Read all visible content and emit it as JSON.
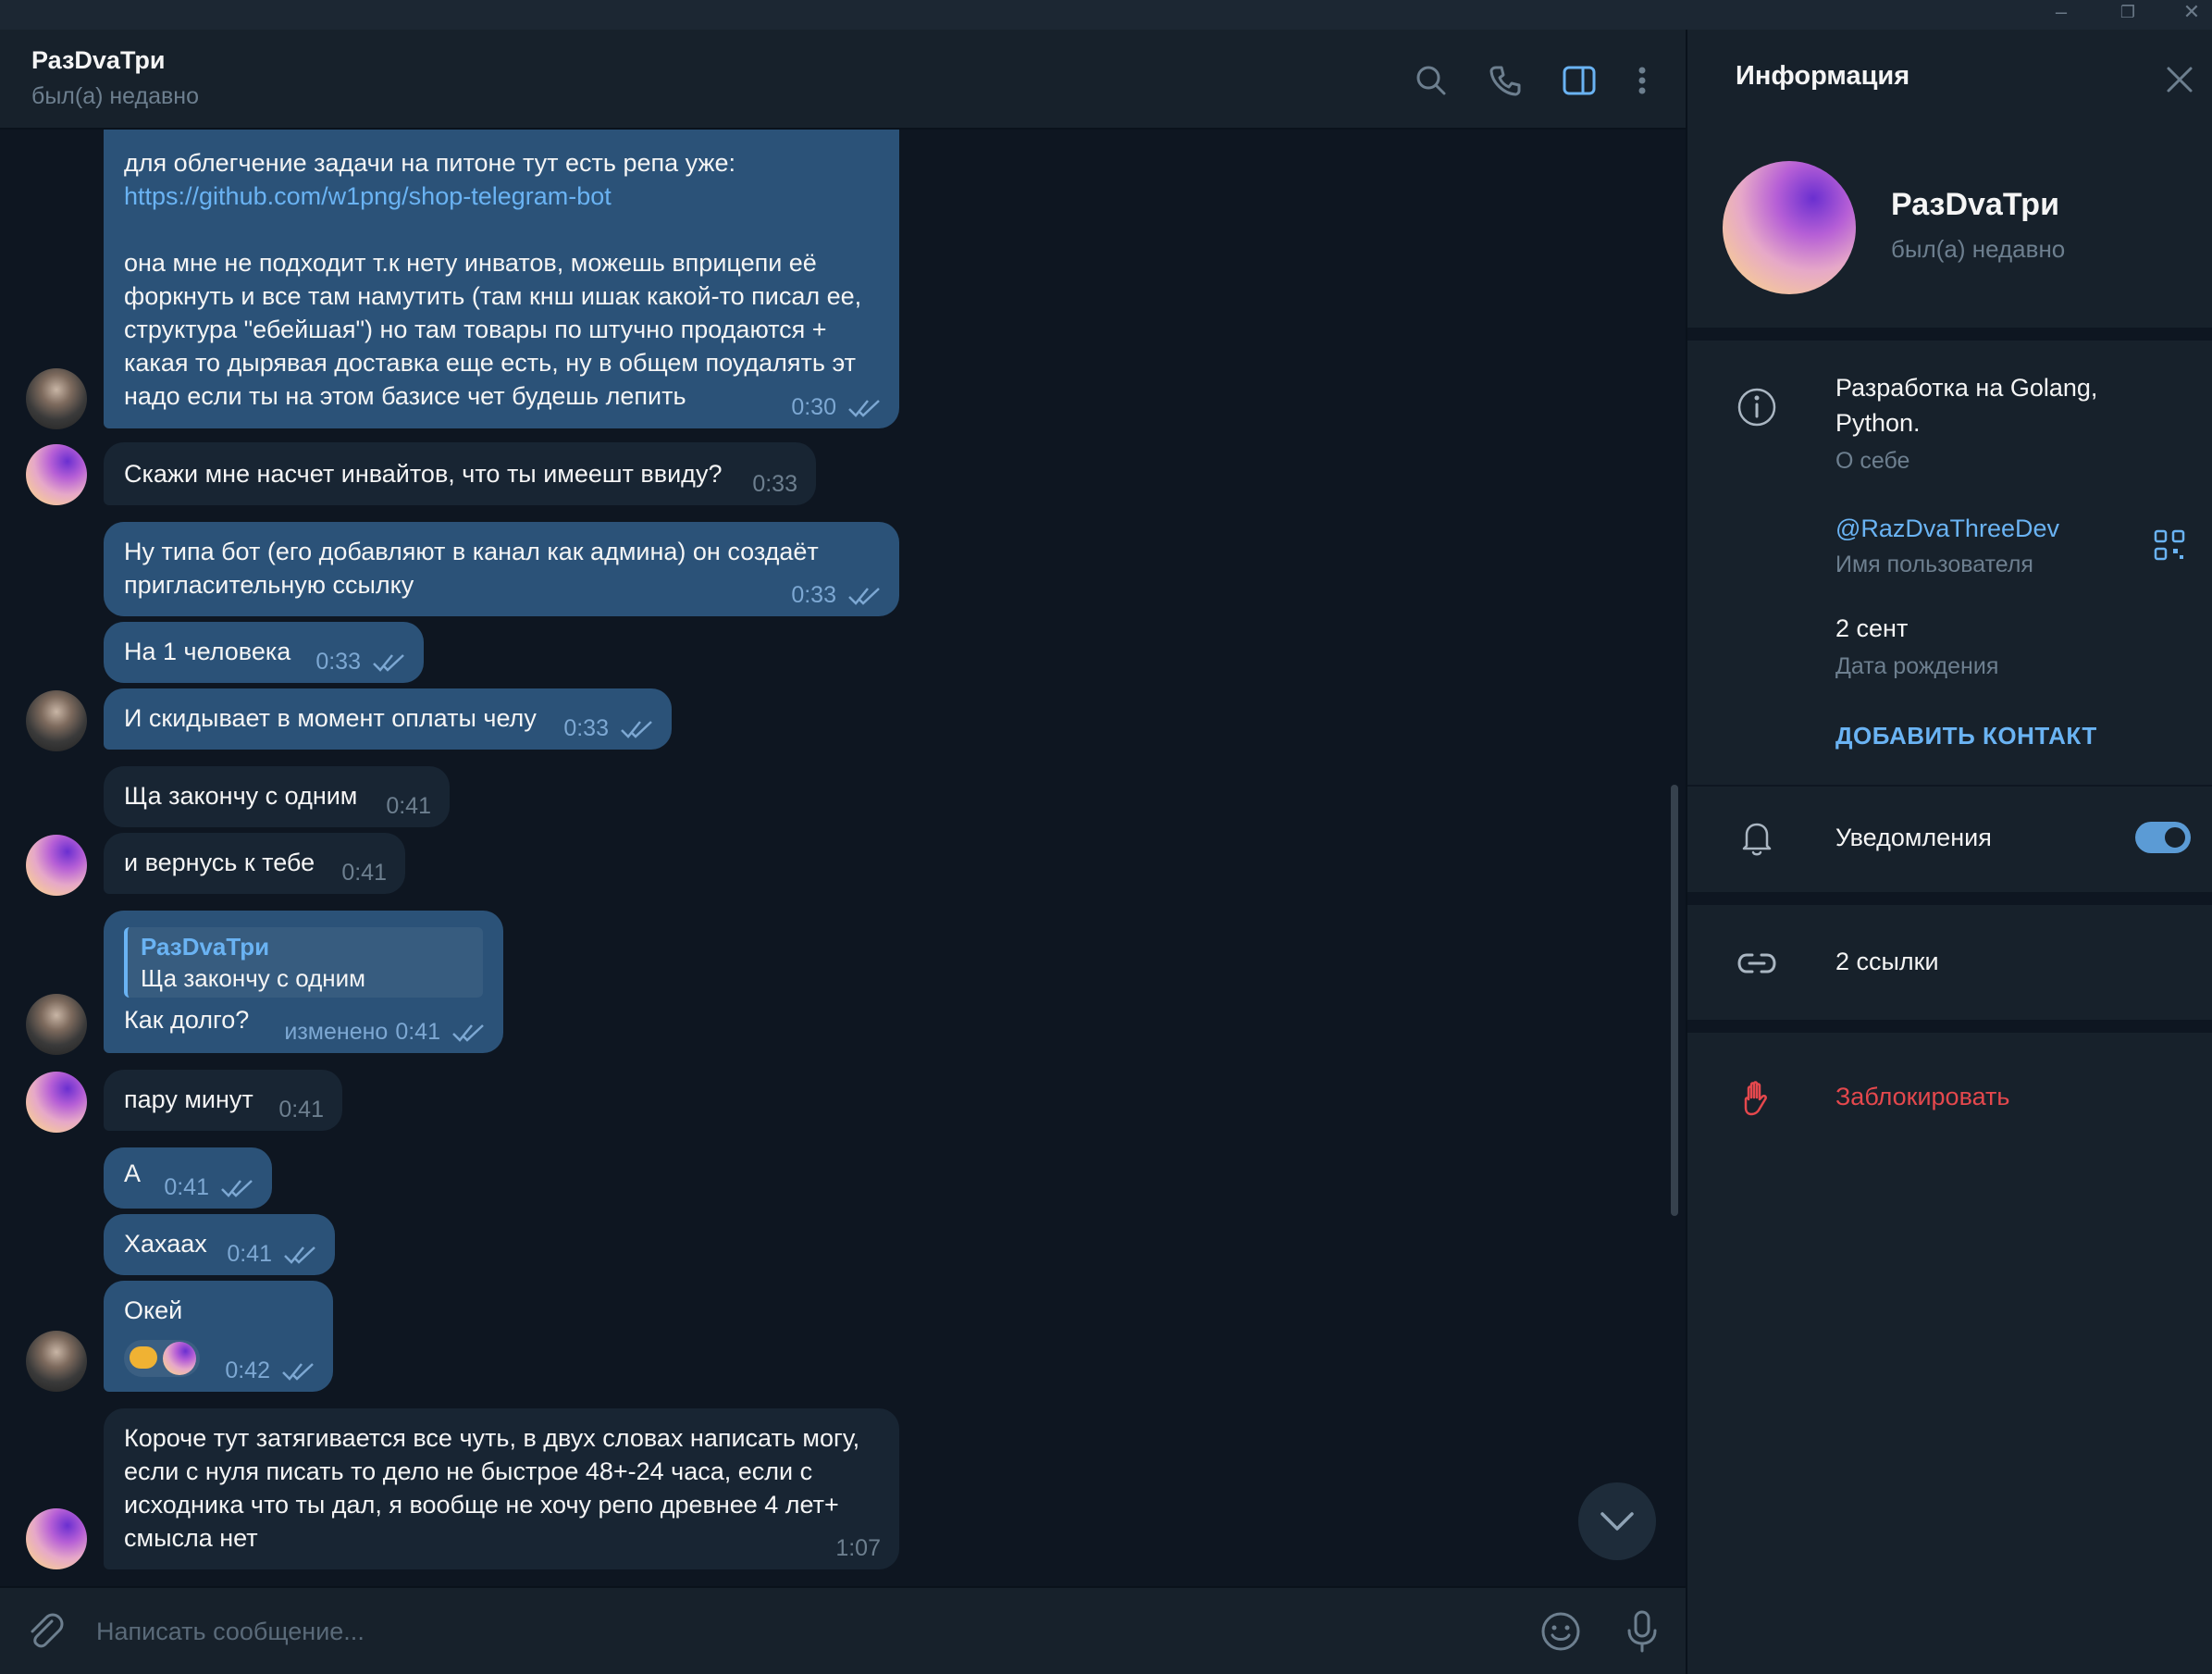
{
  "chat": {
    "title": "РазDvaТри",
    "status": "был(а) недавно"
  },
  "icons": {
    "search": "search-icon",
    "call": "phone-icon",
    "sidebar": "sidebar-toggle-icon",
    "more": "more-vertical-icon",
    "attach": "paperclip-icon",
    "emoji": "emoji-icon",
    "mic": "microphone-icon",
    "scroll_down": "chevron-down-icon"
  },
  "messages": [
    {
      "dir": "out",
      "text_line1": "для облегчение задачи на питоне тут есть репа уже:",
      "link": "https://github.com/w1png/shop-telegram-bot",
      "text_rest": "она мне не подходит т.к нету инватов, можешь вприцепи её\nфоркнуть и все там намутить (там кнш ишак какой-то писал ее,\nструктура \"ебейшая\") но там товары по штучно продаются +\nкакая то дырявая доставка еще есть, ну в общем поудалять эт\nнадо если ты на этом базисе чет будешь лепить",
      "time": "0:30"
    },
    {
      "dir": "in",
      "text": "Скажи мне насчет инвайтов, что ты имеешт ввиду?",
      "time": "0:33"
    },
    {
      "dir": "out",
      "text": "Ну типа бот (его добавляют в канал как админа) он создаёт\nпригласительную ссылку",
      "time": "0:33"
    },
    {
      "dir": "out",
      "text": "На 1 человека",
      "time": "0:33"
    },
    {
      "dir": "out",
      "text": "И скидывает в момент оплаты челу",
      "time": "0:33"
    },
    {
      "dir": "in",
      "text": "Ща закончу с одним",
      "time": "0:41"
    },
    {
      "dir": "in",
      "text": "и вернусь к тебе",
      "time": "0:41"
    },
    {
      "dir": "out",
      "reply_name": "РазDvaТри",
      "reply_text": "Ща закончу с одним",
      "text": "Как долго?",
      "edited": "изменено",
      "time": "0:41"
    },
    {
      "dir": "in",
      "text": "пару минут",
      "time": "0:41"
    },
    {
      "dir": "out",
      "text": "А",
      "time": "0:41"
    },
    {
      "dir": "out",
      "text": "Хахаах",
      "time": "0:41"
    },
    {
      "dir": "out",
      "text": "Окей",
      "reaction": "handshake-emoji",
      "time": "0:42"
    },
    {
      "dir": "in",
      "text": "Короче тут затягивается все чуть, в двух словах написать могу,\nесли с нуля писать то дело не быстрое 48+-24 часа, если с\nисходника что ты дал, я вообще не хочу репо древнее 4 лет+\nсмысла нет",
      "time": "1:07"
    }
  ],
  "composer": {
    "placeholder": "Написать сообщение..."
  },
  "info": {
    "title": "Информация",
    "name": "РазDvaТри",
    "status": "был(а) недавно",
    "bio": "Разработка на Golang,\nPython.",
    "bio_label": "О себе",
    "username": "@RazDvaThreeDev",
    "username_label": "Имя пользователя",
    "birthday": "2 сент",
    "birthday_label": "Дата рождения",
    "add_contact": "ДОБАВИТЬ КОНТАКТ",
    "notifications": "Уведомления",
    "notifications_on": true,
    "links": "2 ссылки",
    "block": "Заблокировать"
  },
  "colors": {
    "bg": "#0e1621",
    "panel": "#17212b",
    "bubble_out": "#2b5278",
    "bubble_in": "#182533",
    "accent": "#6ab3f3",
    "danger": "#e5484d"
  }
}
